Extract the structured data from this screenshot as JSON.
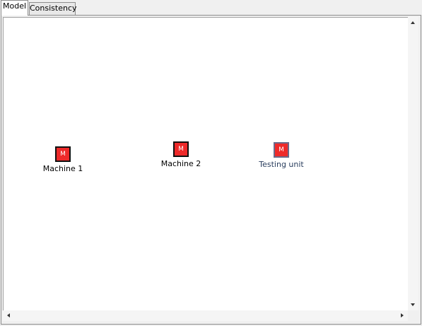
{
  "tabs": [
    {
      "label": "Model",
      "active": true
    },
    {
      "label": "Consistency",
      "active": false
    }
  ],
  "nodes": [
    {
      "icon_text": "M",
      "label": "Machine 1",
      "label_color": "#000000"
    },
    {
      "icon_text": "M",
      "label": "Machine 2",
      "label_color": "#000000"
    },
    {
      "icon_text": "M",
      "label": "Testing unit",
      "label_color": "#2b3f5f"
    }
  ],
  "colors": {
    "node_fill": "#ee2a2a",
    "canvas_background": "#ffffff"
  }
}
